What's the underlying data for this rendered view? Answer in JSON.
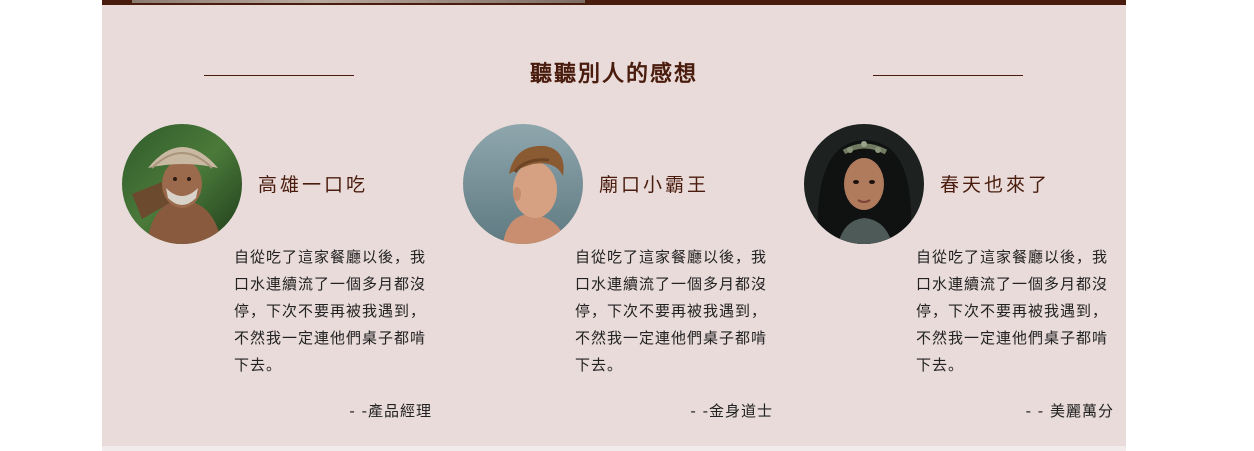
{
  "section": {
    "title": "聽聽別人的感想"
  },
  "testimonials": [
    {
      "name": "高雄一口吃",
      "text": "自從吃了這家餐廳以後，我口水連續流了一個多月都沒停，下次不要再被我遇到，不然我一定連他們桌子都啃下去。",
      "role": "- -產品經理",
      "avatar_icon": "older-man-straw-hat-photo"
    },
    {
      "name": "廟口小霸王",
      "text": "自從吃了這家餐廳以後，我口水連續流了一個多月都沒停，下次不要再被我遇到，不然我一定連他們桌子都啃下去。",
      "role": "- -金身道士",
      "avatar_icon": "young-man-profile-photo"
    },
    {
      "name": "春天也來了",
      "text": "自從吃了這家餐廳以後，我口水連續流了一個多月都沒停，下次不要再被我遇到，不然我一定連他們桌子都啃下去。",
      "role": "- - 美麗萬分",
      "avatar_icon": "woman-flower-crown-photo"
    }
  ],
  "colors": {
    "section_background": "#e8dbd9",
    "accent_dark_brown": "#4a1c0d",
    "body_text": "#222222"
  }
}
